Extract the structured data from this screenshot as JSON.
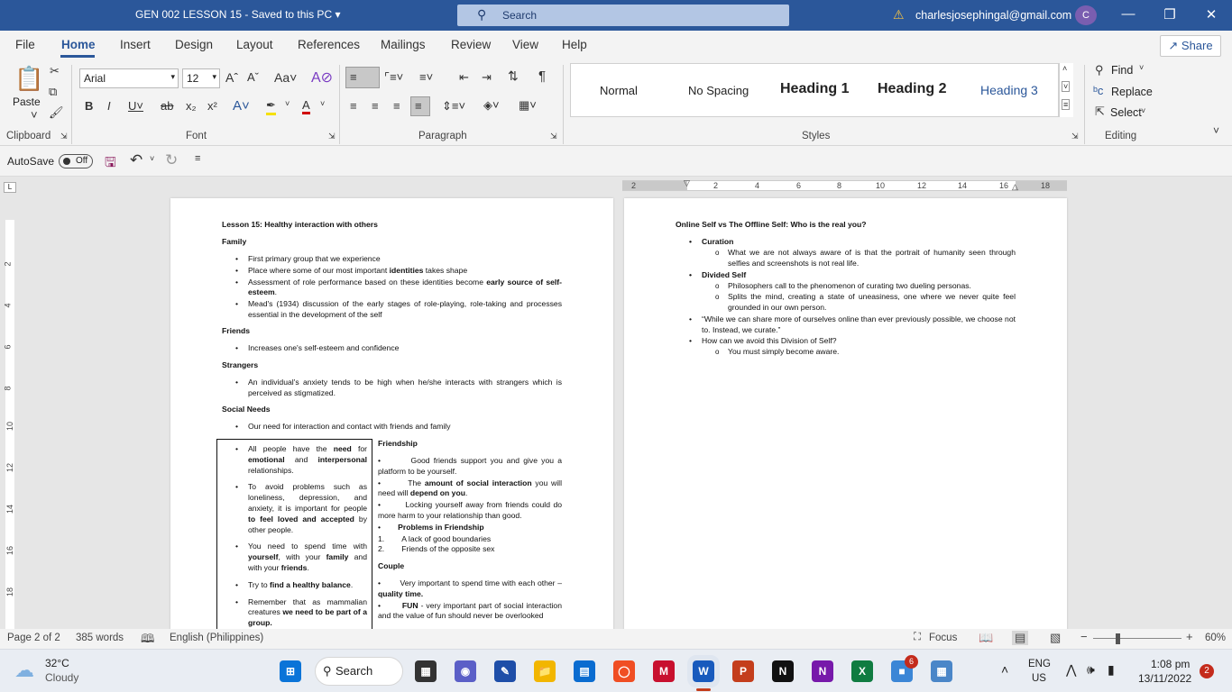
{
  "title_bar": {
    "document": "GEN 002 LESSON 15  -  Saved to this PC  ▾",
    "search": "Search",
    "account": "charlesjosephingal@gmail.com",
    "avatar_initial": "C"
  },
  "menu": {
    "tabs": [
      "File",
      "Home",
      "Insert",
      "Design",
      "Layout",
      "References",
      "Mailings",
      "Review",
      "View",
      "Help"
    ],
    "share": "Share"
  },
  "ribbon": {
    "clipboard": {
      "paste": "Paste",
      "label": "Clipboard"
    },
    "font": {
      "name": "Arial",
      "size": "12",
      "label": "Font"
    },
    "paragraph": {
      "label": "Paragraph"
    },
    "styles": {
      "items": [
        "Normal",
        "No Spacing",
        "Heading 1",
        "Heading 2",
        "Heading 3"
      ],
      "label": "Styles"
    },
    "editing": {
      "find": "Find",
      "replace": "Replace",
      "select": "Select",
      "label": "Editing"
    }
  },
  "qat": {
    "autosave": "AutoSave",
    "toggle": "Off"
  },
  "hruler": {
    "ticks": [
      "2",
      "2",
      "4",
      "6",
      "8",
      "10",
      "12",
      "14",
      "16",
      "18"
    ]
  },
  "vruler": {
    "ticks": [
      "2",
      "4",
      "6",
      "8",
      "10",
      "12",
      "14",
      "16",
      "18"
    ]
  },
  "page1": {
    "title": "Lesson 15: Healthy interaction with others",
    "family_head": "Family",
    "family_items": [
      [
        "First primary group that we experience",
        "",
        ""
      ],
      [
        "Place where some of our most important ",
        "identities",
        " takes shape"
      ],
      [
        "Assessment of role performance based on these identities become ",
        "early source of self-esteem",
        "."
      ],
      [
        "Mead's (1934) discussion of the early stages of role-playing, role-taking and processes essential in the development of the self",
        "",
        ""
      ]
    ],
    "friends_head": "Friends",
    "friends_item": "Increases one's self-esteem and confidence",
    "strangers_head": "Strangers",
    "strangers_item": "An individual's anxiety tends to be high when he/she interacts with strangers which is perceived as stigmatized.",
    "social_head": "Social Needs",
    "social_item": "Our need for interaction and contact with friends and family",
    "box_items": [
      "All people have the <b>need</b> for <b>emotional</b> and <b>interpersonal</b> relationships.",
      "To avoid problems such as loneliness, depression, and anxiety, it is important for people <b>to feel loved and accepted</b> by other people.",
      "You need to spend time with <b>yourself</b>, with your <b>family</b> and with your <b>friends</b>.",
      "Try to <b>find a healthy balance</b>.",
      "Remember that as mammalian creatures <b>we need to be part of a group.</b>"
    ],
    "friendship_head": "Friendship",
    "friendship_items": [
      "Good friends support you and give you a platform to be yourself.",
      "The <b>amount of social interaction</b> you will need will <b>depend on you</b>.",
      "Locking yourself away from friends could do more harm to your relationship than good.",
      "<b>Problems in Friendship</b>"
    ],
    "problems": [
      "A lack of good boundaries",
      "Friends of the opposite sex"
    ],
    "couple_head": "Couple",
    "couple_items": [
      "Very important to spend time with each other – <b>quality time.</b>",
      "<b>FUN</b> - very important part of social interaction and the value of fun should never be overlooked"
    ]
  },
  "page2": {
    "title": "Online Self vs The Offline Self: Who is the real you?",
    "curation": "Curation",
    "curation_sub": "What we are not always aware of is that the portrait of humanity seen through selfies and screenshots is not real life.",
    "divided": "Divided Self",
    "divided_sub1": "Philosophers call to the phenomenon of curating two dueling personas.",
    "divided_sub2": "Splits the mind, creating a state of uneasiness, one where we never quite feel grounded in our own person.",
    "quote": "“While we can share more of ourselves online than ever previously possible, we choose not to. Instead, we curate.”",
    "question": "How can we avoid this Division of Self?",
    "answer": "You must simply become aware."
  },
  "status": {
    "page": "Page 2 of 2",
    "words": "385 words",
    "language": "English (Philippines)",
    "focus": "Focus",
    "zoom": "60%"
  },
  "taskbar": {
    "temp": "32°C",
    "weather": "Cloudy",
    "search": "Search",
    "lang1": "ENG",
    "lang2": "US",
    "time": "1:08 pm",
    "date": "13/11/2022",
    "teams_badge": "6",
    "notif_badge": "2"
  }
}
